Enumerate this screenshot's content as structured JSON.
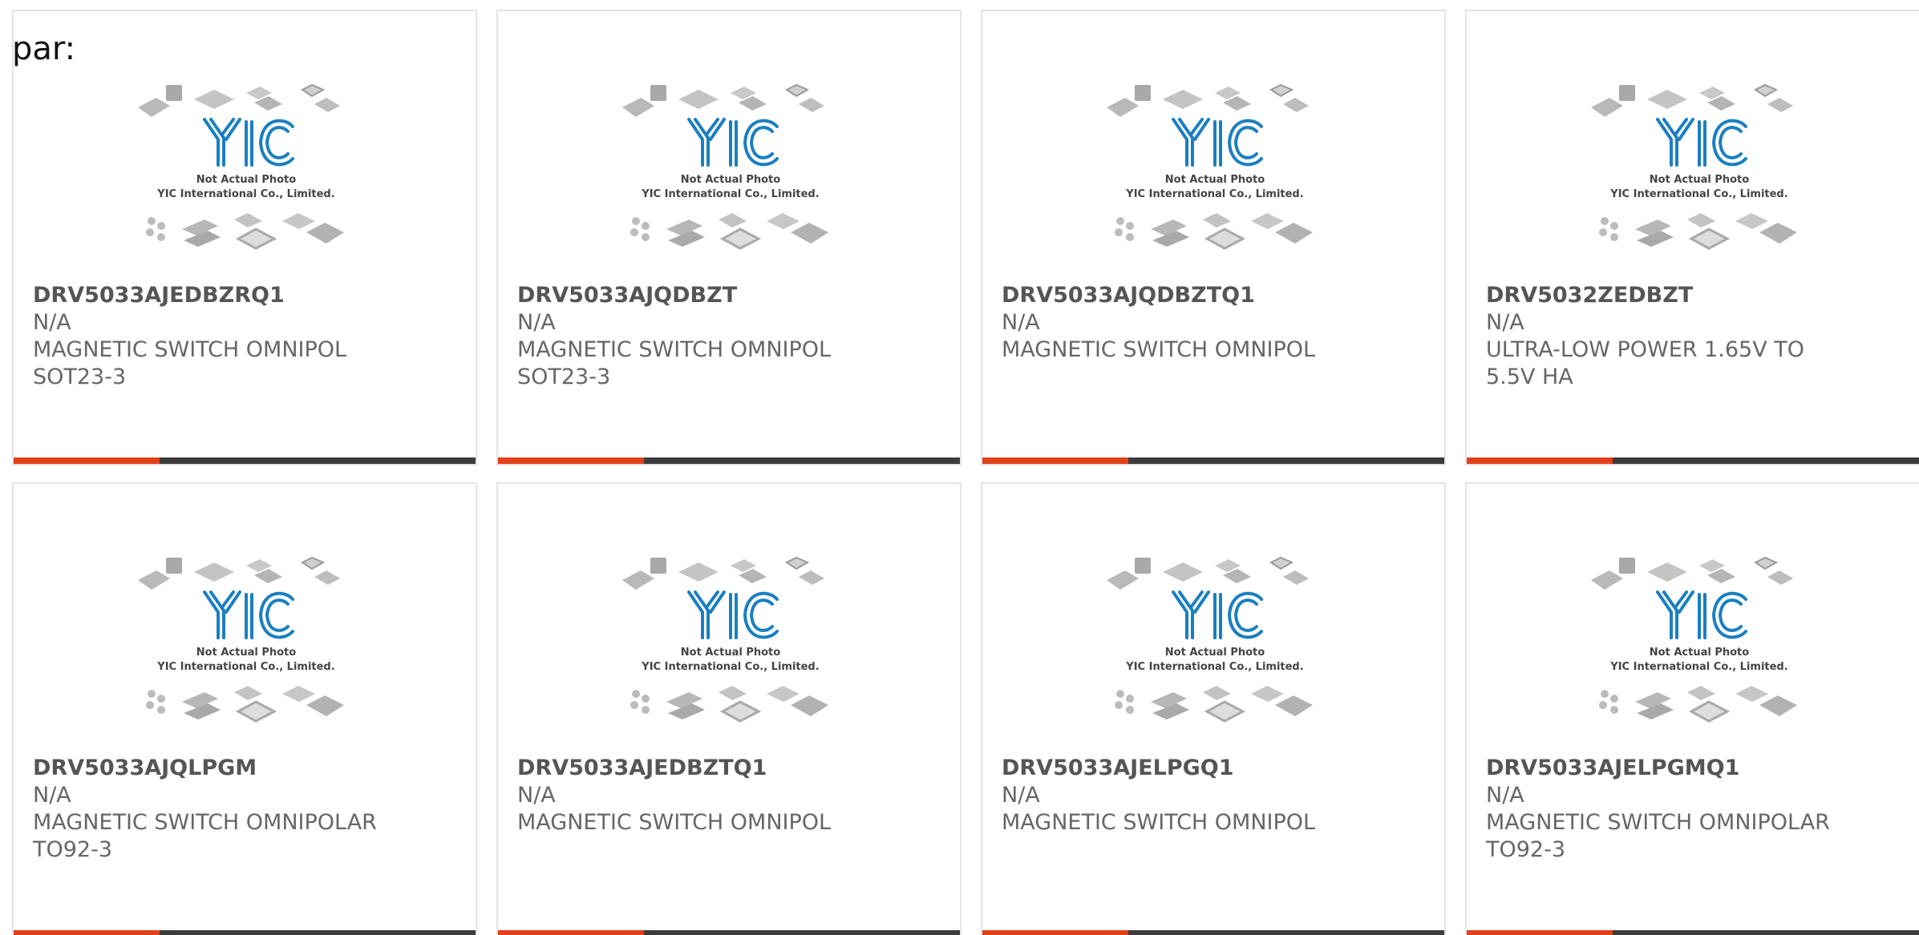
{
  "label": "par:",
  "colors": {
    "accent": "#e2401a",
    "bar": "#3c3c3c",
    "logo": "#1a7fc1",
    "text": "#666666"
  },
  "placeholder_image": {
    "icon": "yic-not-actual-photo",
    "line1": "Not Actual Photo",
    "line2": "YIC International Co., Limited."
  },
  "products": [
    {
      "part": "DRV5033AJEDBZRQ1",
      "manufacturer": "N/A",
      "description": "MAGNETIC SWITCH OMNIPOL SOT23-3"
    },
    {
      "part": "DRV5033AJQDBZT",
      "manufacturer": "N/A",
      "description": "MAGNETIC SWITCH OMNIPOL SOT23-3"
    },
    {
      "part": "DRV5033AJQDBZTQ1",
      "manufacturer": "N/A",
      "description": "MAGNETIC SWITCH OMNIPOL"
    },
    {
      "part": "DRV5032ZEDBZT",
      "manufacturer": "N/A",
      "description": "ULTRA-LOW POWER 1.65V TO 5.5V HA"
    },
    {
      "part": "DRV5033AJQLPGM",
      "manufacturer": "N/A",
      "description": "MAGNETIC SWITCH OMNIPOLAR TO92-3"
    },
    {
      "part": "DRV5033AJEDBZTQ1",
      "manufacturer": "N/A",
      "description": "MAGNETIC SWITCH OMNIPOL"
    },
    {
      "part": "DRV5033AJELPGQ1",
      "manufacturer": "N/A",
      "description": "MAGNETIC SWITCH OMNIPOL"
    },
    {
      "part": "DRV5033AJELPGMQ1",
      "manufacturer": "N/A",
      "description": "MAGNETIC SWITCH OMNIPOLAR TO92-3"
    }
  ]
}
